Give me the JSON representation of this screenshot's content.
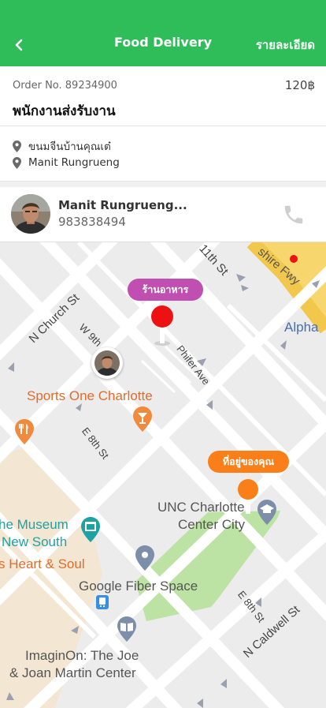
{
  "header": {
    "title": "Food Delivery",
    "detail_label": "รายละเอียด",
    "back_icon": "chevron-left-icon"
  },
  "order": {
    "number": "Order No. 89234900",
    "price": "120฿",
    "title": "พนักงานส่งรับงาน"
  },
  "addresses": [
    {
      "icon": "map-pin-icon",
      "text": "ขนมจีนบ้านคุณเต๋"
    },
    {
      "icon": "map-pin-icon",
      "text": "Manit Rungrueng"
    }
  ],
  "driver": {
    "name": "Manit Rungrueng...",
    "phone": "983838494",
    "call_icon": "phone-icon"
  },
  "map": {
    "pickup_label": "ร้านอาหาร",
    "dropoff_label": "ที่อยู่ของคุณ",
    "streets": {
      "church": "N Church St",
      "ninth": "W 9th",
      "eleventh": "11th St",
      "phifer": "Phifer Ave",
      "e8th": "E 8th St",
      "e8th_2": "E 8th St",
      "caldwell": "N Caldwell St",
      "freeway": "shire Fwy"
    },
    "places": {
      "sports": "Sports One Charlotte",
      "unc_1": "UNC Charlotte",
      "unc_2": "Center City",
      "museum_1": "he Museum",
      "museum_2": "New South",
      "heart": "s Heart & Soul",
      "fiber": "Google Fiber Space",
      "imaginon_1": "ImaginOn: The Joe",
      "imaginon_2": "& Joan Martin Center",
      "alpha": "Alpha"
    }
  },
  "colors": {
    "primary": "#2ebd59",
    "pickup_tag": "#c04fb1",
    "dropoff_tag": "#fa7f19",
    "pickup_marker": "#ee1111",
    "dropoff_marker": "#fa7f19",
    "park": "#bde3a4",
    "freeway": "#f6d66d",
    "poi_orange": "#e06c2c"
  }
}
